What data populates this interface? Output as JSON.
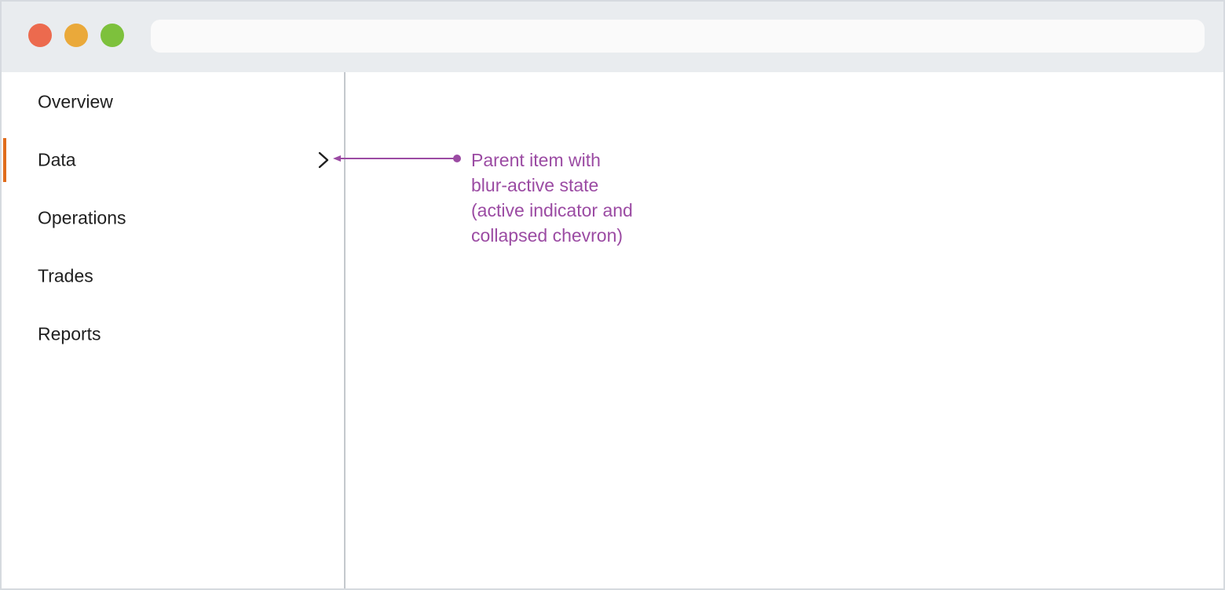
{
  "window": {
    "traffic_lights": [
      {
        "name": "close",
        "color": "#ec6a4e"
      },
      {
        "name": "minimize",
        "color": "#eaa93a"
      },
      {
        "name": "maximize",
        "color": "#7dc13c"
      }
    ],
    "address_bar": {
      "value": ""
    }
  },
  "sidebar": {
    "items": [
      {
        "label": "Overview",
        "active": false
      },
      {
        "label": "Data",
        "active": true,
        "chevron": "chevron-right-icon"
      },
      {
        "label": "Operations",
        "active": false
      },
      {
        "label": "Trades",
        "active": false
      },
      {
        "label": "Reports",
        "active": false
      }
    ],
    "active_indicator_color": "#e06c1c"
  },
  "annotation": {
    "lines": [
      "Parent item with",
      "blur-active state",
      "(active indicator and",
      "collapsed chevron)"
    ],
    "color": "#9b4ba3"
  }
}
